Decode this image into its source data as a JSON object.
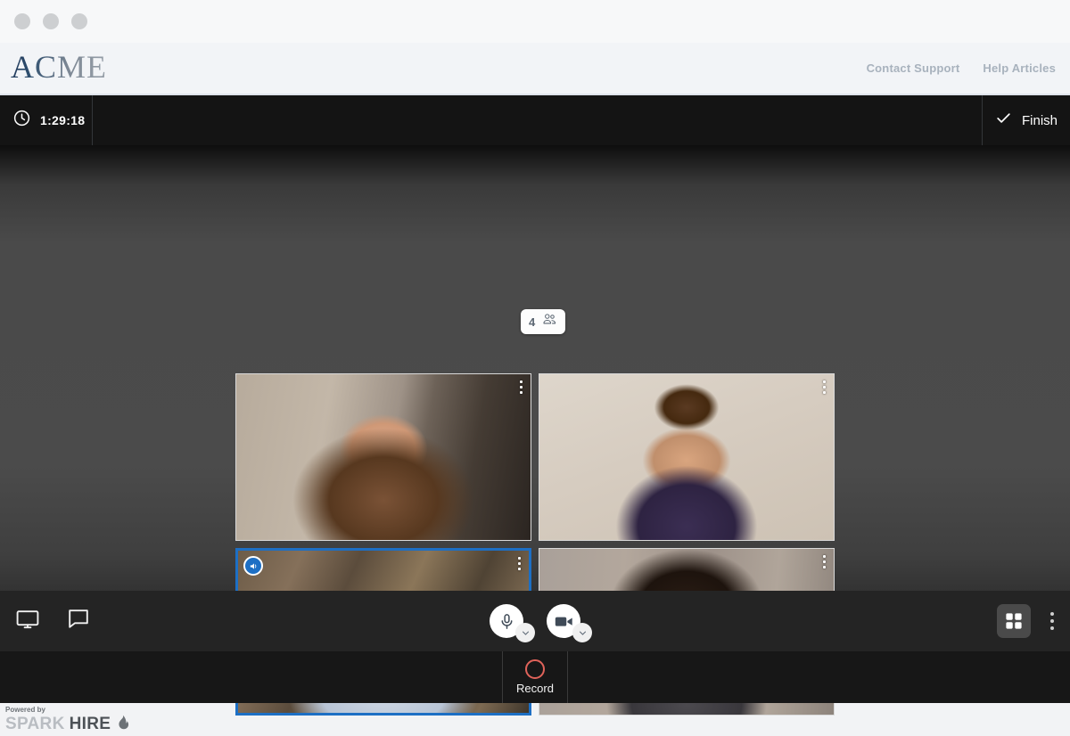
{
  "window": {
    "dots": [
      "window-dot-1",
      "window-dot-2",
      "window-dot-3"
    ]
  },
  "header": {
    "logo_text": "ACME",
    "links": [
      {
        "label": "Contact Support"
      },
      {
        "label": "Help Articles"
      }
    ]
  },
  "timerbar": {
    "clock_icon": "clock-icon",
    "elapsed": "1:29:18",
    "finish_label": "Finish",
    "finish_icon": "check-icon"
  },
  "stage": {
    "participant_count": "4",
    "participants_icon": "people-group-icon",
    "tiles": [
      {
        "id": "participant-1",
        "menu_icon": "kebab-menu-icon",
        "active": false
      },
      {
        "id": "participant-2",
        "menu_icon": "kebab-menu-icon",
        "active": false
      },
      {
        "id": "participant-3",
        "menu_icon": "kebab-menu-icon",
        "active": true,
        "badge_icon": "speaker-icon"
      },
      {
        "id": "participant-4",
        "menu_icon": "kebab-menu-icon",
        "active": false
      }
    ]
  },
  "controls": {
    "screen_share_icon": "monitor-screen-share-icon",
    "chat_icon": "chat-bubble-icon",
    "microphone_icon": "microphone-icon",
    "microphone_caret_icon": "chevron-down-icon",
    "camera_icon": "video-camera-icon",
    "camera_caret_icon": "chevron-down-icon",
    "grid_view_icon": "grid-view-icon",
    "more_options_icon": "kebab-menu-icon"
  },
  "recordbar": {
    "record_label": "Record",
    "record_icon": "record-circle-icon"
  },
  "footer": {
    "powered_by": "Powered by",
    "brand_light": "SPARK",
    "brand_dark": "HIRE",
    "flame_icon": "flame-icon"
  },
  "colors": {
    "accent_blue": "#1d6fc4",
    "record_red": "#e0635a",
    "header_bg": "#f2f4f7",
    "bar_dark": "#141414"
  }
}
